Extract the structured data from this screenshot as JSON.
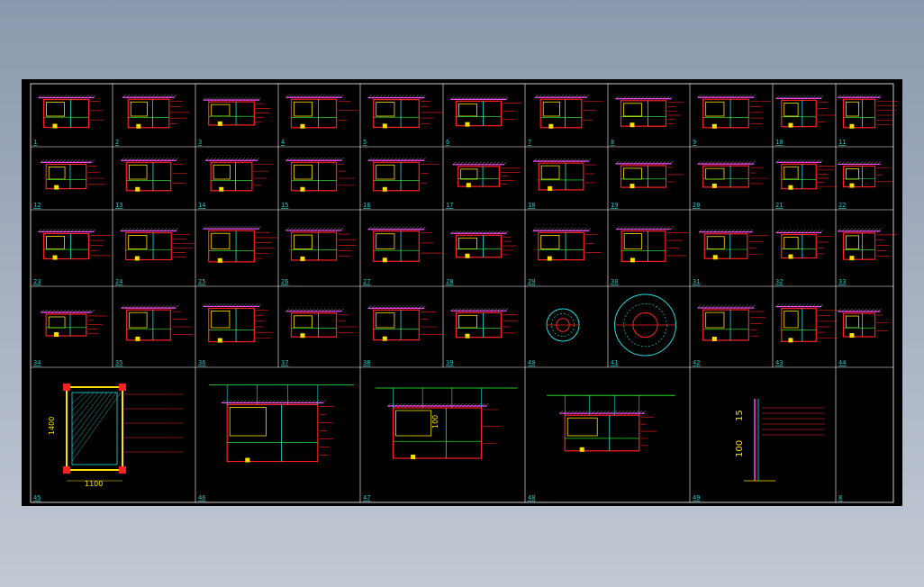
{
  "drawing": {
    "cells": [
      {
        "label": "1"
      },
      {
        "label": "2"
      },
      {
        "label": "3"
      },
      {
        "label": "4"
      },
      {
        "label": "5"
      },
      {
        "label": "6"
      },
      {
        "label": "7"
      },
      {
        "label": "8"
      },
      {
        "label": "9"
      },
      {
        "label": "10"
      },
      {
        "label": "11"
      },
      {
        "label": "12"
      },
      {
        "label": "13"
      },
      {
        "label": "14"
      },
      {
        "label": "15"
      },
      {
        "label": "16"
      },
      {
        "label": "17"
      },
      {
        "label": "18"
      },
      {
        "label": "19"
      },
      {
        "label": "20"
      },
      {
        "label": "21"
      },
      {
        "label": "22"
      },
      {
        "label": "23"
      },
      {
        "label": "24"
      },
      {
        "label": "25"
      },
      {
        "label": "26"
      },
      {
        "label": "27"
      },
      {
        "label": "28"
      },
      {
        "label": "29"
      },
      {
        "label": "30"
      },
      {
        "label": "31"
      },
      {
        "label": "32"
      },
      {
        "label": "33"
      },
      {
        "label": "34"
      },
      {
        "label": "35"
      },
      {
        "label": "36"
      },
      {
        "label": "37"
      },
      {
        "label": "38"
      },
      {
        "label": "39"
      },
      {
        "label": "40"
      },
      {
        "label": "41"
      },
      {
        "label": "42"
      },
      {
        "label": "43"
      },
      {
        "label": "44"
      },
      {
        "label": "45"
      },
      {
        "label": "46"
      },
      {
        "label": "47"
      },
      {
        "label": "48"
      },
      {
        "label": "49"
      },
      {
        "label": "8"
      }
    ],
    "dimensions": {
      "detail45_width": "1100",
      "detail45_height": "1400",
      "detail47_height": "100",
      "detail49_top": "15",
      "detail49_bottom": "100"
    },
    "colors": {
      "background": "#000000",
      "grid": "#ffffff",
      "primary_line": "#ff2020",
      "secondary_line": "#ffe000",
      "accent_line": "#20e0e0",
      "magenta": "#ff40ff",
      "green": "#30ff30",
      "label": "#20c8c8"
    }
  }
}
